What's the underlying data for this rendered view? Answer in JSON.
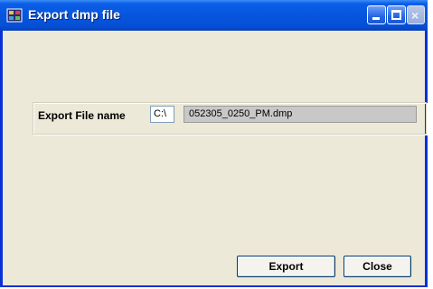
{
  "window": {
    "title": "Export dmp file",
    "title_icon": "app-icon",
    "controls": {
      "minimize_icon": "minimize-icon",
      "maximize_icon": "maximize-icon",
      "close_icon": "close-icon",
      "close_glyph": "×"
    }
  },
  "form": {
    "label": "Export File name",
    "drive_value": "C:\\",
    "filename_value": "052305_0250_PM.dmp"
  },
  "buttons": {
    "export_label": "Export",
    "close_label": "Close"
  },
  "colors": {
    "titlebar": "#0855dd",
    "frame_border": "#0831d9",
    "background": "#ece9d8",
    "filename_field": "#c8c8c8"
  }
}
